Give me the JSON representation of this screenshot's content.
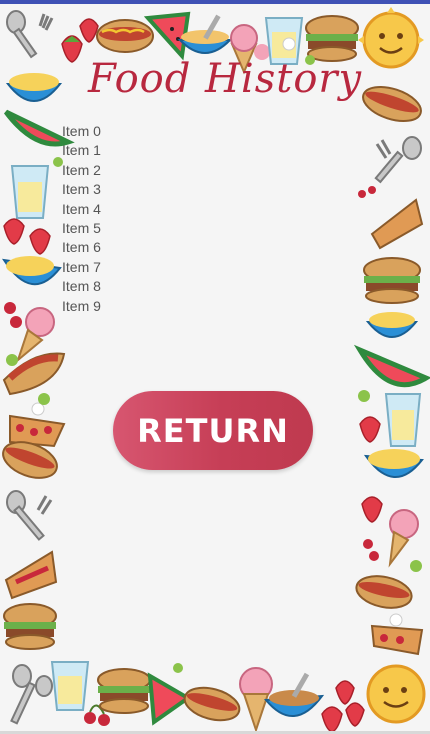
{
  "header": {
    "title": "Food History"
  },
  "history": {
    "items": [
      "Item 0",
      "Item 1",
      "Item 2",
      "Item 3",
      "Item 4",
      "Item 5",
      "Item 6",
      "Item 7",
      "Item 8",
      "Item 9"
    ]
  },
  "actions": {
    "return_label": "RETURN"
  },
  "theme": {
    "status_bar": "#3f51b5",
    "title_color": "#b8283f",
    "button_color": "#c63e56",
    "background": "#f5f5f5"
  },
  "border_icons": [
    "fork-spoon-icon",
    "strawberry-icon",
    "hotdog-icon",
    "watermelon-icon",
    "cereal-bowl-icon",
    "ice-cream-icon",
    "lemonade-icon",
    "burger-icon",
    "sun-icon",
    "pie-icon",
    "grape-icon"
  ]
}
